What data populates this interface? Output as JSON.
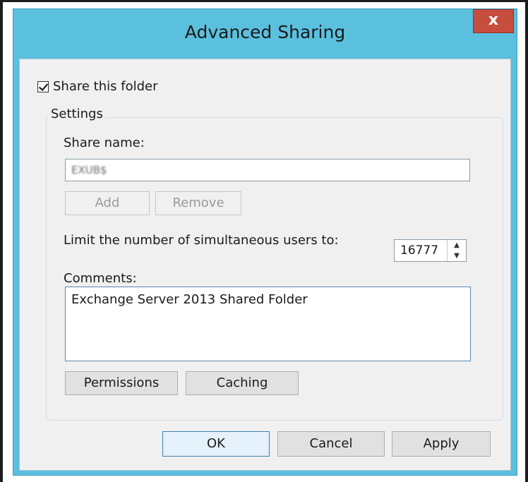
{
  "dialog": {
    "title": "Advanced Sharing",
    "close_label": "x",
    "share_checkbox_label": "Share this folder",
    "share_checkbox_checked": true,
    "settings_group_title": "Settings",
    "share_name_label": "Share name:",
    "share_name_value": "EXUB$",
    "add_label": "Add",
    "remove_label": "Remove",
    "limit_label": "Limit the number of simultaneous users to:",
    "limit_value": "16777",
    "comments_label": "Comments:",
    "comments_value": "Exchange Server 2013 Shared Folder",
    "permissions_label": "Permissions",
    "caching_label": "Caching",
    "ok_label": "OK",
    "cancel_label": "Cancel",
    "apply_label": "Apply"
  }
}
